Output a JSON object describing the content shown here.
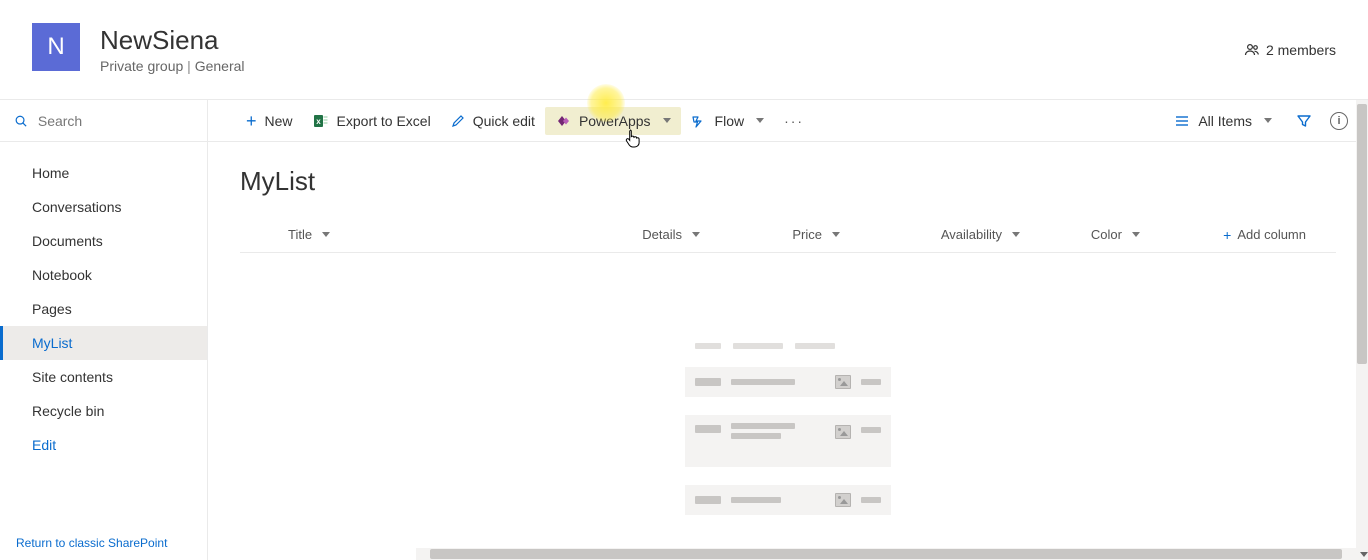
{
  "header": {
    "logo_letter": "N",
    "title": "NewSiena",
    "subtitle_left": "Private group",
    "subtitle_right": "General",
    "members_label": "2 members"
  },
  "search": {
    "placeholder": "Search"
  },
  "nav": {
    "items": [
      {
        "label": "Home"
      },
      {
        "label": "Conversations"
      },
      {
        "label": "Documents"
      },
      {
        "label": "Notebook"
      },
      {
        "label": "Pages"
      },
      {
        "label": "MyList"
      },
      {
        "label": "Site contents"
      },
      {
        "label": "Recycle bin"
      },
      {
        "label": "Edit"
      }
    ],
    "return_link": "Return to classic SharePoint"
  },
  "commands": {
    "new": "New",
    "export": "Export to Excel",
    "quick_edit": "Quick edit",
    "powerapps": "PowerApps",
    "flow": "Flow",
    "all_items": "All Items"
  },
  "list": {
    "title": "MyList",
    "columns": {
      "title": "Title",
      "details": "Details",
      "price": "Price",
      "availability": "Availability",
      "color": "Color",
      "add": "Add column"
    }
  }
}
